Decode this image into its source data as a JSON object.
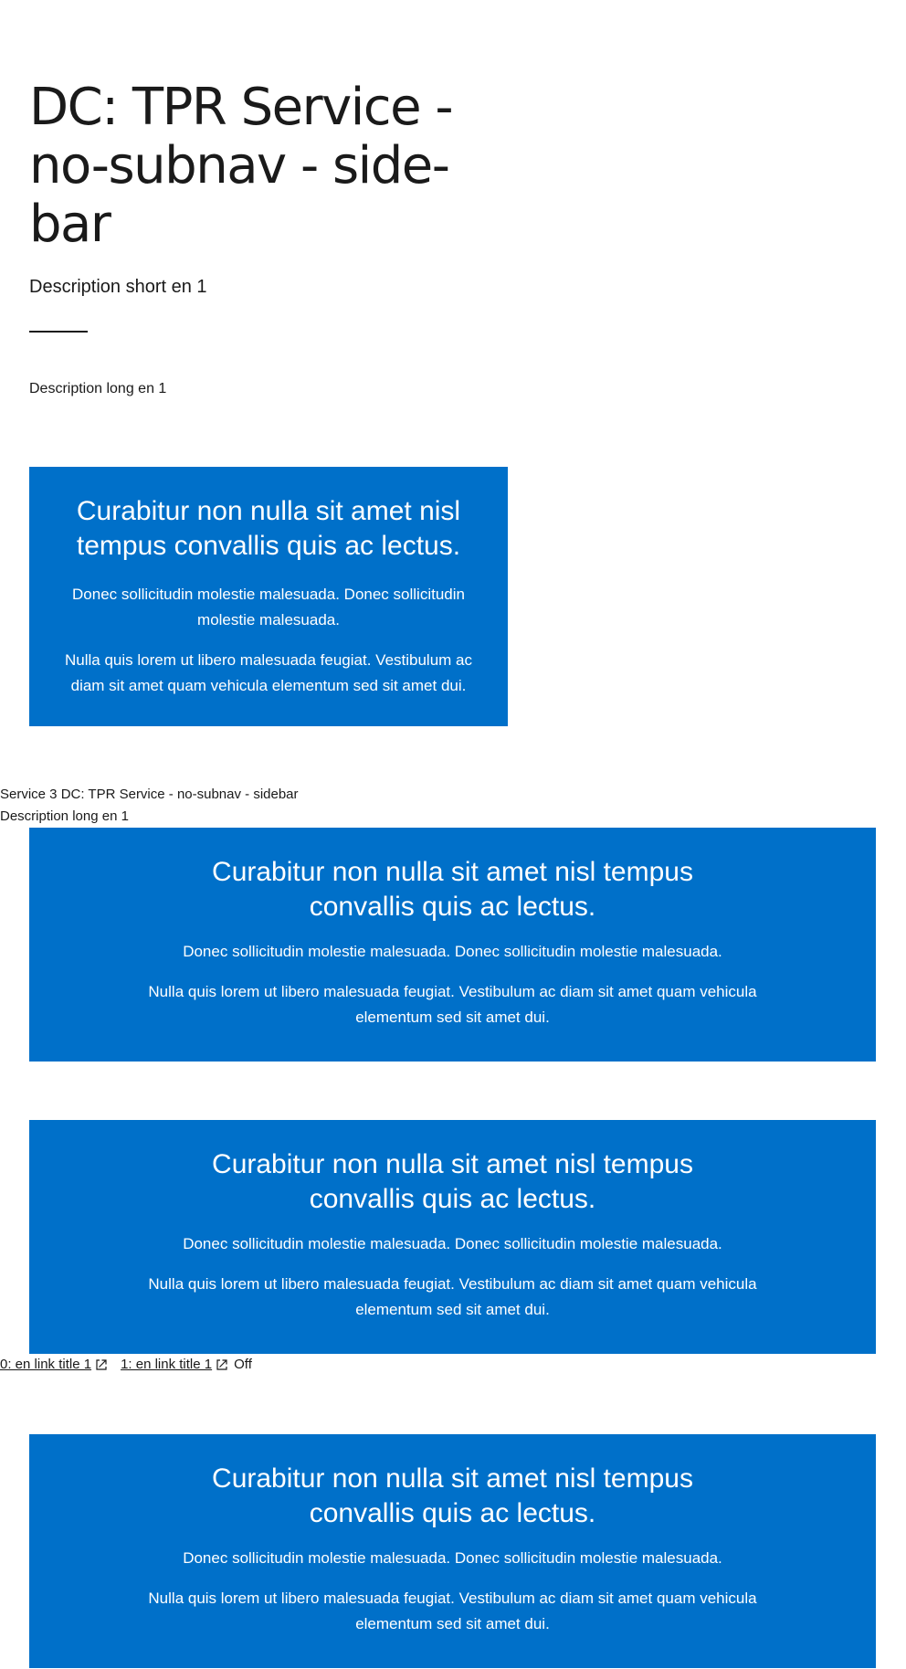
{
  "hero": {
    "title": "DC: TPR Service - no-subnav - side-bar",
    "short_description": "Description short en 1",
    "long_description": "Description long en 1"
  },
  "promo_narrow": {
    "heading": "Curabitur non nulla sit amet nisl tempus convallis quis ac lectus.",
    "text_1": "Donec sollicitudin molestie malesuada. Donec sollicitudin molestie malesuada.",
    "text_2": "Nulla quis lorem ut libero malesuada feugiat. Vestibulum ac diam sit amet quam vehicula elementum sed sit amet dui."
  },
  "sidebar": {
    "service_title": "Service 3 DC: TPR Service - no-subnav - sidebar",
    "long_description": "Description long en 1"
  },
  "promos_wide": [
    {
      "heading": "Curabitur non nulla sit amet nisl tempus convallis quis ac lectus.",
      "text_1": "Donec sollicitudin molestie malesuada. Donec sollicitudin molestie malesuada.",
      "text_2": "Nulla quis lorem ut libero malesuada feugiat. Vestibulum ac diam sit amet quam vehicula elementum sed sit amet dui."
    },
    {
      "heading": "Curabitur non nulla sit amet nisl tempus convallis quis ac lectus.",
      "text_1": "Donec sollicitudin molestie malesuada. Donec sollicitudin molestie malesuada.",
      "text_2": "Nulla quis lorem ut libero malesuada feugiat. Vestibulum ac diam sit amet quam vehicula elementum sed sit amet dui."
    },
    {
      "heading": "Curabitur non nulla sit amet nisl tempus convallis quis ac lectus.",
      "text_1": "Donec sollicitudin molestie malesuada. Donec sollicitudin molestie malesuada.",
      "text_2": "Nulla quis lorem ut libero malesuada feugiat. Vestibulum ac diam sit amet quam vehicula elementum sed sit amet dui."
    }
  ],
  "links": {
    "items": [
      {
        "label": "0: en link title 1",
        "icon": "external-link-icon"
      },
      {
        "label": "1: en link title 1",
        "icon": "external-link-icon"
      }
    ],
    "status": "Off"
  },
  "colors": {
    "promo_background": "#0070c9",
    "text": "#1a1a1a"
  }
}
